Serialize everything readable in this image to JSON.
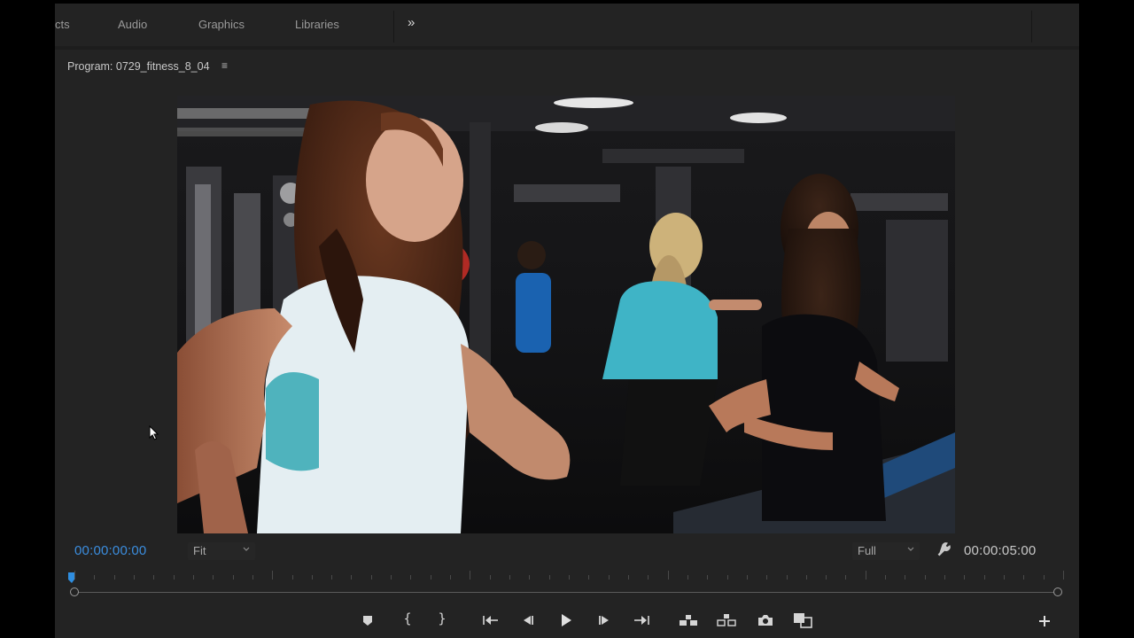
{
  "tabs": [
    {
      "label": "cts"
    },
    {
      "label": "Audio"
    },
    {
      "label": "Graphics"
    },
    {
      "label": "Libraries"
    }
  ],
  "more_tabs_glyph": "»",
  "monitor": {
    "title": "Program: 0729_fitness_8_04",
    "menu_glyph": "≡",
    "timecode_current": "00:00:00:00",
    "timecode_duration": "00:00:05:00",
    "zoom_select": "Fit",
    "resolution_select": "Full",
    "playhead_position": 0.0
  },
  "controls": {
    "mark_in": "{",
    "mark_out": "}"
  },
  "icons": [
    "chevron-double-right-icon",
    "panel-menu-icon",
    "wrench-icon",
    "add-marker-icon",
    "go-to-in-icon",
    "step-back-icon",
    "play-icon",
    "step-forward-icon",
    "go-to-out-icon",
    "lift-icon",
    "extract-icon",
    "camera-icon",
    "compare-icon",
    "plus-icon",
    "mouse-pointer-icon"
  ],
  "colors": {
    "accent_timecode": "#3b8dde",
    "panel_bg": "#232323"
  }
}
